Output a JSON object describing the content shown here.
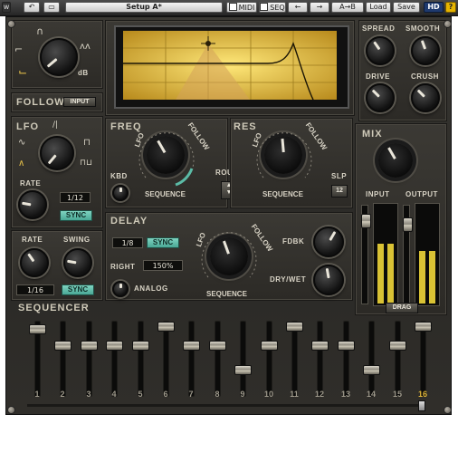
{
  "toolbar": {
    "preset_name": "Setup A*",
    "midi_label": "MIDI",
    "seq_label": "SEQ",
    "ab_label": "A→B",
    "load_label": "Load",
    "save_label": "Save",
    "hd_label": "HD",
    "help_label": "?"
  },
  "filter_section": {
    "follow_label": "FOLLOW",
    "input_button": "INPUT",
    "db_label": "dB"
  },
  "lfo": {
    "label": "LFO",
    "rate_label": "RATE",
    "rate_value": "1/12",
    "sync_label": "SYNC"
  },
  "freq": {
    "label": "FREQ",
    "kbd_label": "KBD",
    "ring_lfo": "LFO",
    "ring_follow": "FOLLOW",
    "ring_sequence": "SEQUENCE"
  },
  "res": {
    "label": "RES",
    "slp_label": "SLP",
    "slp_value": "12",
    "ring_lfo": "LFO",
    "ring_follow": "FOLLOW",
    "ring_sequence": "SEQUENCE"
  },
  "route_label": "ROUTE",
  "right_section": {
    "spread_label": "SPREAD",
    "smooth_label": "SMOOTH",
    "drive_label": "DRIVE",
    "crush_label": "CRUSH",
    "mix_label": "MIX",
    "input_label": "INPUT",
    "output_label": "OUTPUT"
  },
  "delay": {
    "label": "DELAY",
    "time_value": "1/8",
    "sync_label": "SYNC",
    "right_label": "RIGHT",
    "right_value": "150%",
    "analog_label": "ANALOG",
    "fdbk_label": "FDBK",
    "drywet_label": "DRY/WET",
    "ring_lfo": "LFO",
    "ring_follow": "FOLLOW",
    "ring_sequence": "SEQUENCE"
  },
  "seq_rate": {
    "rate_label": "RATE",
    "swing_label": "SWING",
    "rate_value": "1/16",
    "sync_label": "SYNC"
  },
  "sequencer": {
    "label": "SEQUENCER",
    "drag_label": "DRAG",
    "current_step": 16,
    "steps": [
      {
        "num": "1",
        "level": 0.95
      },
      {
        "num": "2",
        "level": 0.68
      },
      {
        "num": "3",
        "level": 0.68
      },
      {
        "num": "4",
        "level": 0.68
      },
      {
        "num": "5",
        "level": 0.68
      },
      {
        "num": "6",
        "level": 0.99
      },
      {
        "num": "7",
        "level": 0.68
      },
      {
        "num": "8",
        "level": 0.68
      },
      {
        "num": "9",
        "level": 0.3
      },
      {
        "num": "10",
        "level": 0.68
      },
      {
        "num": "11",
        "level": 0.99
      },
      {
        "num": "12",
        "level": 0.68
      },
      {
        "num": "13",
        "level": 0.68
      },
      {
        "num": "14",
        "level": 0.3
      },
      {
        "num": "15",
        "level": 0.68
      },
      {
        "num": "16",
        "level": 0.99
      }
    ]
  },
  "meters": {
    "input_levels": [
      0.62,
      0.62
    ],
    "output_levels": [
      0.55,
      0.55
    ]
  },
  "colors": {
    "screen_yellow": "#e8c24a",
    "sync_teal": "#5bbba6",
    "meter_yellow": "#d9c234",
    "active_step": "#e0b63a"
  }
}
